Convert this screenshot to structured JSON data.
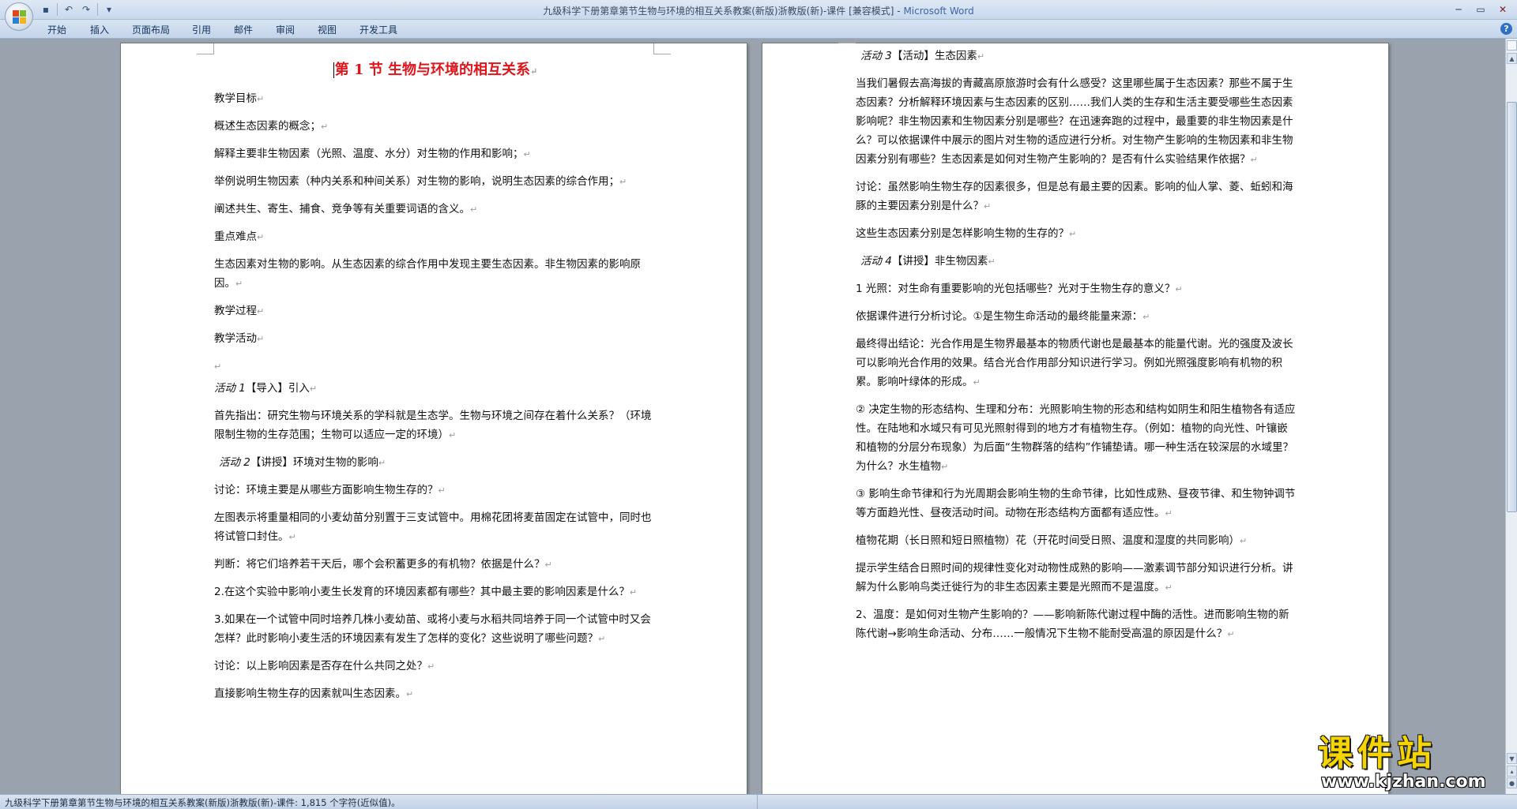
{
  "window": {
    "title": "九级科学下册第章第节生物与环境的相互关系教案(新版)浙教版(新)-课件 [兼容模式] - ",
    "app_name": "Microsoft Word",
    "controls": {
      "minimize": "─",
      "maximize": "▭",
      "close": "✕"
    }
  },
  "quick_access": {
    "save": "▪",
    "undo": "↶",
    "redo": "↷",
    "more": "▾"
  },
  "ribbon": {
    "tabs": [
      {
        "label": "开始"
      },
      {
        "label": "插入"
      },
      {
        "label": "页面布局"
      },
      {
        "label": "引用"
      },
      {
        "label": "邮件"
      },
      {
        "label": "审阅"
      },
      {
        "label": "视图"
      },
      {
        "label": "开发工具"
      }
    ],
    "help": "?"
  },
  "pilcrow": "↵",
  "left_page": {
    "heading": "第 1 节  生物与环境的相互关系",
    "paras": [
      "教学目标",
      "概述生态因素的概念；",
      "解释主要非生物因素（光照、温度、水分）对生物的作用和影响；",
      "举例说明生物因素（种内关系和种间关系）对生物的影响，说明生态因素的综合作用；",
      "阐述共生、寄生、捕食、竞争等有关重要词语的含义。",
      "重点难点",
      "生态因素对生物的影响。从生态因素的综合作用中发现主要生态因素。非生物因素的影响原因。",
      "教学过程",
      "教学活动",
      ""
    ],
    "activity1": {
      "label": "活动 1",
      "text": "【导入】引入"
    },
    "paras2": [
      "首先指出：研究生物与环境关系的学科就是生态学。生物与环境之间存在着什么关系？（环境限制生物的生存范围；生物可以适应一定的环境）"
    ],
    "activity2": {
      "label": "活动 2",
      "text": "【讲授】环境对生物的影响"
    },
    "paras3": [
      "讨论：环境主要是从哪些方面影响生物生存的？",
      "左图表示将重量相同的小麦幼苗分别置于三支试管中。用棉花团将麦苗固定在试管中，同时也将试管口封住。",
      "判断：将它们培养若干天后，哪个会积蓄更多的有机物？依据是什么？",
      "2.在这个实验中影响小麦生长发育的环境因素都有哪些？其中最主要的影响因素是什么？",
      "3.如果在一个试管中同时培养几株小麦幼苗、或将小麦与水稻共同培养于同一个试管中时又会怎样？此时影响小麦生活的环境因素有发生了怎样的变化？这些说明了哪些问题？",
      "讨论：以上影响因素是否存在什么共同之处？",
      "直接影响生物生存的因素就叫生态因素。"
    ]
  },
  "right_page": {
    "activity3": {
      "label": "活动 3",
      "text": "【活动】生态因素"
    },
    "paras": [
      "当我们暑假去高海拔的青藏高原旅游时会有什么感受？这里哪些属于生态因素？那些不属于生态因素？分析解释环境因素与生态因素的区别……我们人类的生存和生活主要受哪些生态因素影响呢？非生物因素和生物因素分别是哪些？在迅速奔跑的过程中，最重要的非生物因素是什么？可以依据课件中展示的图片对生物的适应进行分析。对生物产生影响的生物因素和非生物因素分别有哪些？生态因素是如何对生物产生影响的？是否有什么实验结果作依据？",
      "讨论：虽然影响生物生存的因素很多，但是总有最主要的因素。影响的仙人掌、菱、蚯蚓和海豚的主要因素分别是什么？",
      "这些生态因素分别是怎样影响生物的生存的？"
    ],
    "activity4": {
      "label": "活动 4",
      "text": "【讲授】非生物因素"
    },
    "paras2": [
      "1 光照：对生命有重要影响的光包括哪些？光对于生物生存的意义？",
      "依据课件进行分析讨论。①是生物生命活动的最终能量来源：",
      "最终得出结论：光合作用是生物界最基本的物质代谢也是最基本的能量代谢。光的强度及波长可以影响光合作用的效果。结合光合作用部分知识进行学习。例如光照强度影响有机物的积累。影响叶绿体的形成。",
      "② 决定生物的形态结构、生理和分布：光照影响生物的形态和结构如阴生和阳生植物各有适应性。在陆地和水域只有可见光照射得到的地方才有植物生存。（例如：植物的向光性、叶镶嵌和植物的分层分布现象）为后面“生物群落的结构”作铺垫请。哪一种生活在较深层的水域里？为什么？水生植物",
      "③ 影响生命节律和行为光周期会影响生物的生命节律，比如性成熟、昼夜节律、和生物钟调节等方面趋光性、昼夜活动时间。动物在形态结构方面都有适应性。",
      "植物花期（长日照和短日照植物）花（开花时间受日照、温度和湿度的共同影响）",
      "提示学生结合日照时间的规律性变化对动物性成熟的影响——激素调节部分知识进行分析。讲解为什么影响鸟类迁徙行为的非生态因素主要是光照而不是温度。",
      "2、温度：是如何对生物产生影响的？——影响新陈代谢过程中酶的活性。进而影响生物的新陈代谢→影响生命活动、分布……一般情况下生物不能耐受高温的原因是什么？"
    ]
  },
  "status_bar": {
    "text": "九级科学下册第章第节生物与环境的相互关系教案(新版)浙教版(新)-课件: 1,815 个字符(近似值)。"
  },
  "watermark": {
    "main": "课件站",
    "url": "www.kjzhan.com"
  },
  "colors": {
    "heading": "#e0141b",
    "workspace": "#9aa3ad",
    "watermark": "#f5d400"
  }
}
